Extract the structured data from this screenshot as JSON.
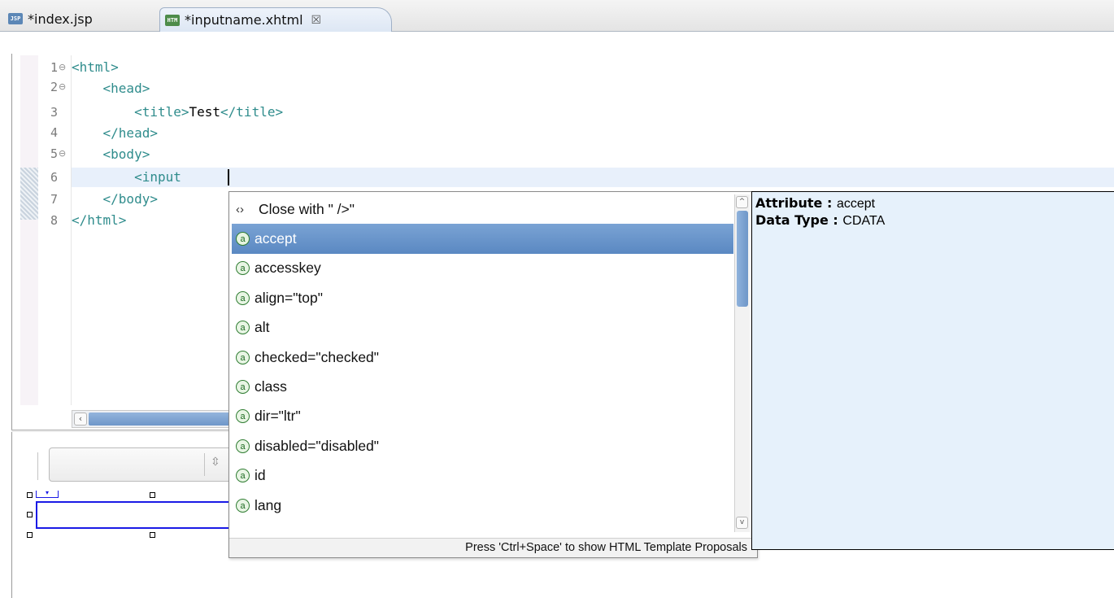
{
  "tabs": [
    {
      "label": "*index.jsp",
      "icon": "jsp-file-icon",
      "icon_text": "JSP"
    },
    {
      "label": "*inputname.xhtml",
      "icon": "html-file-icon",
      "icon_text": "HTM",
      "close": "☒",
      "active": true
    }
  ],
  "editor": {
    "line_numbers": [
      "1",
      "2",
      "3",
      "4",
      "5",
      "6",
      "7",
      "8"
    ],
    "lines": [
      {
        "text": "<html>"
      },
      {
        "text": "    <head>"
      },
      {
        "pre": "        <title>",
        "mid": "Test",
        "post": "</title>"
      },
      {
        "text": "    </head>"
      },
      {
        "text": "    <body>"
      },
      {
        "text": "        <input "
      },
      {
        "text": "    </body>"
      },
      {
        "text": "</html>"
      }
    ],
    "current_line": 6
  },
  "completion": {
    "items": [
      {
        "label": "Close with \" />\"",
        "icon": "close-tag-icon",
        "glyph": "‹›"
      },
      {
        "label": "accept",
        "icon": "attribute-icon",
        "glyph": "a",
        "selected": true
      },
      {
        "label": "accesskey",
        "icon": "attribute-icon",
        "glyph": "a"
      },
      {
        "label": "align=\"top\"",
        "icon": "attribute-icon",
        "glyph": "a"
      },
      {
        "label": "alt",
        "icon": "attribute-icon",
        "glyph": "a"
      },
      {
        "label": "checked=\"checked\"",
        "icon": "attribute-icon",
        "glyph": "a"
      },
      {
        "label": "class",
        "icon": "attribute-icon",
        "glyph": "a"
      },
      {
        "label": "dir=\"ltr\"",
        "icon": "attribute-icon",
        "glyph": "a"
      },
      {
        "label": "disabled=\"disabled\"",
        "icon": "attribute-icon",
        "glyph": "a"
      },
      {
        "label": "id",
        "icon": "attribute-icon",
        "glyph": "a"
      },
      {
        "label": "lang",
        "icon": "attribute-icon",
        "glyph": "a"
      }
    ],
    "status": "Press 'Ctrl+Space' to show HTML Template Proposals"
  },
  "info": {
    "attribute_label": "Attribute : ",
    "attribute_value": "accept",
    "datatype_label": "Data Type : ",
    "datatype_value": "CDATA"
  },
  "colors": {
    "tag": "#2f8c8c",
    "selection": "#6a95c9",
    "info_background": "#e6f1fb",
    "design_box": "#1a1ae6"
  }
}
